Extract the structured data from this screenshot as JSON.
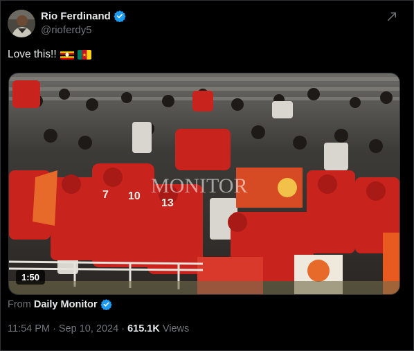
{
  "author": {
    "display_name": "Rio Ferdinand",
    "handle": "@rioferdy5"
  },
  "tweet": {
    "text": "Love this!!",
    "flags": [
      "uganda-flag",
      "cameroon-flag"
    ]
  },
  "video": {
    "duration": "1:50",
    "watermark": "MONITOR"
  },
  "source": {
    "prefix": "From",
    "name": "Daily Monitor"
  },
  "meta": {
    "time": "11:54 PM",
    "date": "Sep 10, 2024",
    "views_count": "615.1K",
    "views_label": "Views"
  },
  "colors": {
    "background": "#000000",
    "text_primary": "#e7e9ea",
    "text_secondary": "#71767b",
    "verified_blue": "#1d9bf0",
    "crowd_red": "#c8231d"
  }
}
